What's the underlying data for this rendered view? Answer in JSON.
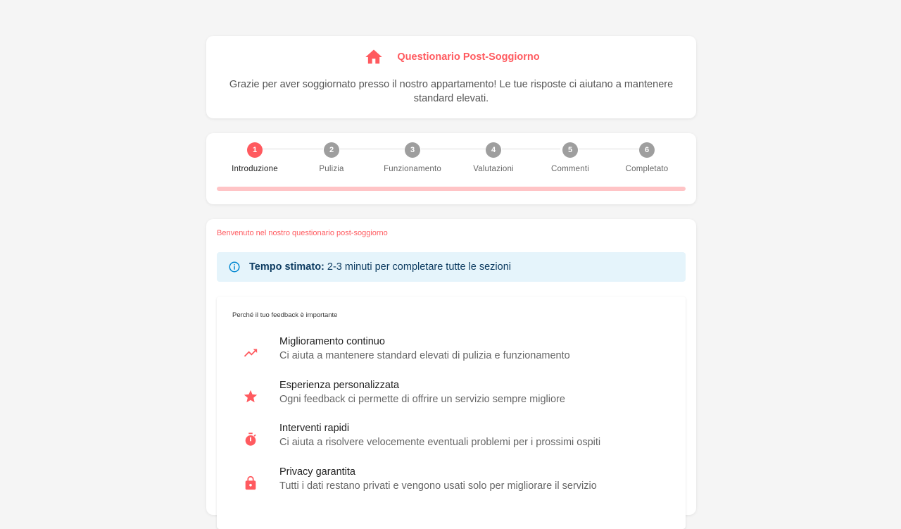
{
  "header": {
    "icon": "home-icon",
    "title": "Questionario Post-Soggiorno",
    "subtitle": "Grazie per aver soggiornato presso il nostro appartamento! Le tue risposte ci aiutano a mantenere standard elevati."
  },
  "stepper": {
    "active_step": 1,
    "progress": 0,
    "steps": [
      {
        "number": "1",
        "label": "Introduzione"
      },
      {
        "number": "2",
        "label": "Pulizia"
      },
      {
        "number": "3",
        "label": "Funzionamento"
      },
      {
        "number": "4",
        "label": "Valutazioni"
      },
      {
        "number": "5",
        "label": "Commenti"
      },
      {
        "number": "6",
        "label": "Completato"
      }
    ]
  },
  "main": {
    "welcome": "Benvenuto nel nostro questionario post-soggiorno",
    "info": {
      "icon": "info-icon",
      "label": "Tempo stimato:",
      "text": "2-3 minuti per completare tutte le sezioni"
    },
    "feedback": {
      "title": "Perché il tuo feedback è importante",
      "items": [
        {
          "icon": "trending-up-icon",
          "title": "Miglioramento continuo",
          "description": "Ci aiuta a mantenere standard elevati di pulizia e funzionamento"
        },
        {
          "icon": "star-icon",
          "title": "Esperienza personalizzata",
          "description": "Ogni feedback ci permette di offrire un servizio sempre migliore"
        },
        {
          "icon": "timer-icon",
          "title": "Interventi rapidi",
          "description": "Ci aiuta a risolvere velocemente eventuali problemi per i prossimi ospiti"
        },
        {
          "icon": "lock-icon",
          "title": "Privacy garantita",
          "description": "Tutti i dati restano privati e vengono usati solo per migliorare il servizio"
        }
      ]
    }
  },
  "colors": {
    "accent": "#ff5a5f",
    "accent_light": "#ffc4c6",
    "inactive_step": "#9e9e9e",
    "info_bg": "#e5f4fb",
    "info_text": "#0d3c61",
    "background": "#f5f5f5"
  }
}
